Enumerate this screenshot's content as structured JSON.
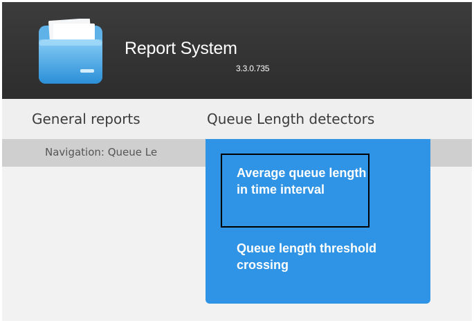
{
  "app": {
    "title": "Report System",
    "version": "3.3.0.735",
    "logo_icon": "folder-icon",
    "header_color": "#333333"
  },
  "menu": {
    "items": [
      {
        "label": "General reports"
      },
      {
        "label": "Queue Length detectors"
      }
    ]
  },
  "breadcrumb": {
    "text": "Navigation: Queue Le"
  },
  "dropdown": {
    "accent_color": "#2f93e6",
    "items": [
      {
        "label": "Average queue length in time interval",
        "highlighted": true
      },
      {
        "label": "Queue length threshold crossing",
        "highlighted": false
      }
    ]
  }
}
